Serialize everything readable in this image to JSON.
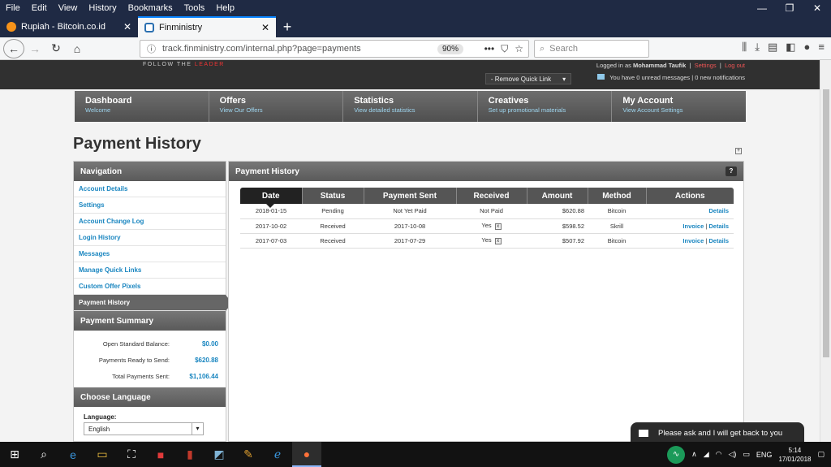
{
  "browser": {
    "menu": [
      "File",
      "Edit",
      "View",
      "History",
      "Bookmarks",
      "Tools",
      "Help"
    ],
    "tabs": [
      {
        "title": "Rupiah - Bitcoin.co.id",
        "close": "✕"
      },
      {
        "title": "Finministry",
        "close": "✕"
      }
    ],
    "new_tab": "+",
    "url": "track.finministry.com/internal.php?page=payments",
    "zoom": "90%",
    "search_placeholder": "Search",
    "accent_color": "#0a84ff"
  },
  "header": {
    "tagline_left": "FOLLOW THE",
    "tagline_right": "LEADER",
    "quick_link": "- Remove Quick Link",
    "logged_in_prefix": "Logged in as",
    "user": "Mohammad Taufik",
    "settings": "Settings",
    "logout": "Log out",
    "messages": "You have 0 unread messages | 0 new notifications"
  },
  "mainnav": [
    {
      "title": "Dashboard",
      "sub": "Welcome"
    },
    {
      "title": "Offers",
      "sub": "View Our Offers"
    },
    {
      "title": "Statistics",
      "sub": "View detailed statistics"
    },
    {
      "title": "Creatives",
      "sub": "Set up promotional materials"
    },
    {
      "title": "My Account",
      "sub": "View Account Settings"
    }
  ],
  "page_title": "Payment History",
  "sidebar": {
    "nav_title": "Navigation",
    "links": [
      "Account Details",
      "Settings",
      "Account Change Log",
      "Login History",
      "Messages",
      "Manage Quick Links",
      "Custom Offer Pixels",
      "Payment History"
    ],
    "summary_title": "Payment Summary",
    "summary": [
      {
        "label": "Open Standard Balance:",
        "value": "$0.00"
      },
      {
        "label": "Payments Ready to Send:",
        "value": "$620.88"
      },
      {
        "label": "Total Payments Sent:",
        "value": "$1,106.44"
      }
    ],
    "lang_title": "Choose Language",
    "lang_label": "Language:",
    "lang_value": "English"
  },
  "content": {
    "title": "Payment History",
    "help": "?",
    "columns": [
      "Date",
      "Status",
      "Payment Sent",
      "Received",
      "Amount",
      "Method",
      "Actions"
    ],
    "rows": [
      {
        "date": "2018-01-15",
        "status": "Pending",
        "sent": "Not Yet Paid",
        "received": "Not Paid",
        "amount": "$620.88",
        "method": "Bitcoin",
        "invoice": "",
        "details": "Details"
      },
      {
        "date": "2017-10-02",
        "status": "Received",
        "sent": "2017-10-08",
        "received": "Yes",
        "amount": "$598.52",
        "method": "Skrill",
        "invoice": "Invoice",
        "details": "Details"
      },
      {
        "date": "2017-07-03",
        "status": "Received",
        "sent": "2017-07-29",
        "received": "Yes",
        "amount": "$507.92",
        "method": "Bitcoin",
        "invoice": "Invoice",
        "details": "Details"
      }
    ]
  },
  "chat": "Please ask and I will get back to you",
  "taskbar": {
    "lang": "ENG",
    "time": "5:14",
    "date": "17/01/2018"
  }
}
